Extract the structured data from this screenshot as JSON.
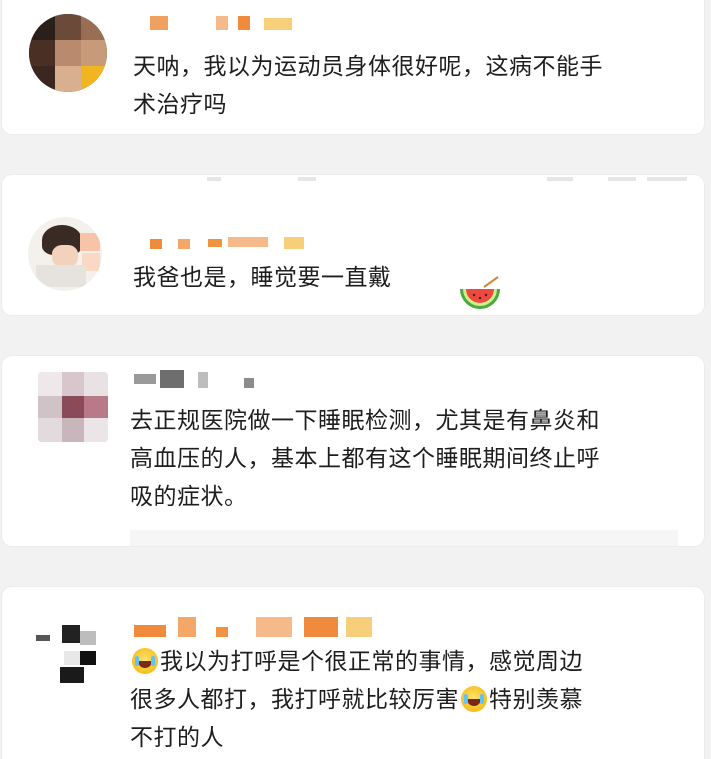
{
  "comments": [
    {
      "lines": [
        "天呐，我以为运动员身体很好呢，这病不能手",
        "术治疗吗"
      ]
    },
    {
      "lines": [
        "我爸也是，睡觉要一直戴"
      ],
      "emoji": "watermelon"
    },
    {
      "lines": [
        "去正规医院做一下睡眠检测，尤其是有鼻炎和",
        "高血压的人，基本上都有这个睡眠期间终止呼",
        "吸的症状。"
      ]
    },
    {
      "line1_a": "我以为打呼是个很正常的事情，感觉周边",
      "line2_a": "很多人都打，我打呼就比较厉害",
      "line2_b": "特别羡慕",
      "line3": "不打的人",
      "emoji": "laugh-cry"
    }
  ],
  "colors": {
    "background": "#f2f2f2",
    "card": "#ffffff",
    "text": "#1e1e1e",
    "username_blur": "#f08a3c"
  }
}
